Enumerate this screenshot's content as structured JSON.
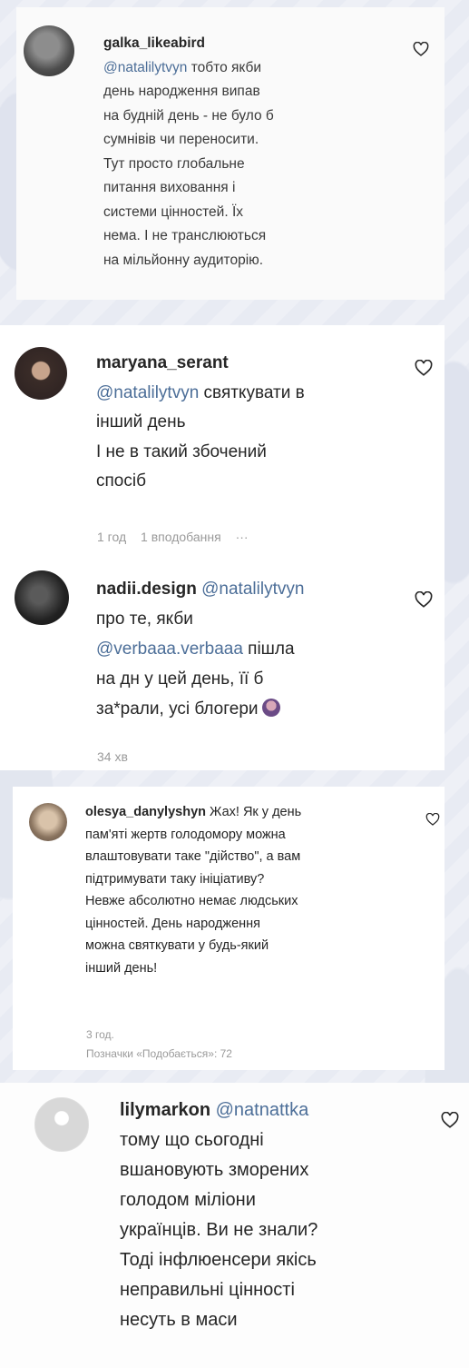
{
  "comments": [
    {
      "username": "galka_likeabird",
      "mention": "@natalilytvyn",
      "text": " тобто якби\nдень народження випав\nна будній день - не було б\nсумнівів чи переносити.\nТут просто глобальне\nпитання виховання і\nсистеми цінностей. Їх\nнема. І не транслюються\nна мільйонну аудиторію."
    },
    {
      "username": "maryana_serant",
      "mention": "@natalilytvyn",
      "text": " святкувати в\nінший день\nІ не в такий збочений\nспосіб",
      "time": "1 год",
      "likes": "1 вподобання",
      "more": "···"
    },
    {
      "username": "nadii.design",
      "mention": "@natalilytvyn",
      "text_a": "\nпро те, якби\n",
      "mention2": "@verbaaa.verbaaa",
      "text_b": " пішла\nна дн у цей день, її б\nза*рали, усі блогери",
      "time": "34 хв"
    },
    {
      "username": "olesya_danylyshyn",
      "text": "Жах! Як у день\nпам'яті жертв голодомору можна\nвлаштовувати таке \"дійство\", а вам\nпідтримувати таку ініціативу?\nНевже абсолютно немає людських\nцінностей. День народження\nможна святкувати у будь-який\nінший день!",
      "time": "3 год.",
      "likes": "Позначки «Подобається»: 72"
    },
    {
      "username": "lilymarkon",
      "mention": "@natnattka",
      "text": "\nтому що сьогодні\nвшановують зморених\nголодом міліони\nукраїнців. Ви не знали?\nТоді інфлюенсери якісь\nнеправильні цінності\nнесуть в маси"
    }
  ],
  "colors": {
    "mention": "#4c6e98",
    "meta": "#9a9a9a",
    "text": "#262626",
    "background": "#eef0f6"
  },
  "icons": {
    "like": "heart-outline-icon",
    "avatar_placeholder": "default-avatar-icon"
  }
}
